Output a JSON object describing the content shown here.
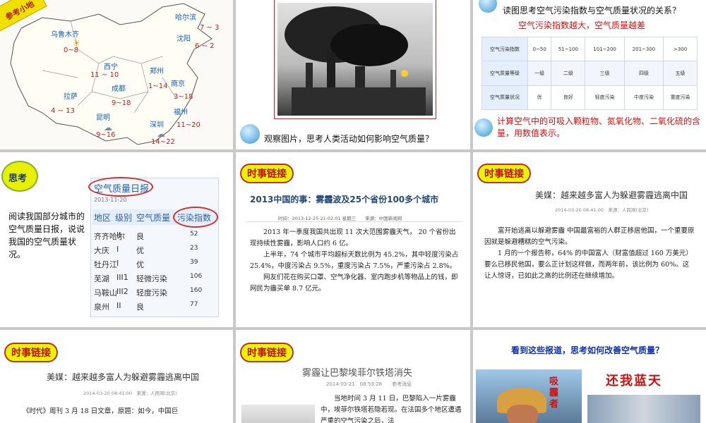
{
  "s1": {
    "badge": "参考小地",
    "cities": [
      {
        "name": "乌鲁木齐",
        "temp": "0~8"
      },
      {
        "name": "哈尔滨",
        "temp": "7 ~ 3"
      },
      {
        "name": "沈阳",
        "temp": "6 ~ 2"
      },
      {
        "name": "西宁",
        "temp": "11 ~ 10"
      },
      {
        "name": "郑州",
        "temp": "1~14"
      },
      {
        "name": "成都",
        "temp": "9~18"
      },
      {
        "name": "南京",
        "temp": "3~18"
      },
      {
        "name": "拉萨",
        "temp": "4 ~ 13"
      },
      {
        "name": "福州",
        "temp": "11~20"
      },
      {
        "name": "昆明",
        "temp": "9~16"
      },
      {
        "name": "深圳",
        "temp": "14~22"
      }
    ]
  },
  "s2": {
    "caption": "观察图片，思考人类活动如何影响空气质量？"
  },
  "s3": {
    "question": "读图思考空气污染指数与空气质量状况的关系？",
    "answer": "空气污染指数越大，空气质量越差",
    "rows": [
      {
        "label": "空气污染指数",
        "cells": [
          "0~50",
          "51~100",
          "101~200",
          "201~300",
          ">300"
        ]
      },
      {
        "label": "空气质量等级",
        "cells": [
          "一级",
          "二级",
          "三级",
          "四级",
          "五级"
        ]
      },
      {
        "label": "空气质量状况",
        "cells": [
          "优",
          "良好",
          "轻度污染",
          "中度污染",
          "重度污染"
        ]
      }
    ],
    "note": "计算空气中的可吸入颗粒物、氮氧化物、二氧化硫的含量，用数值表示。"
  },
  "s4": {
    "tag": "思考",
    "prompt": "阅读我国部分城市的空气质量日报，说说我国的空气质量状况。",
    "report_title": "空气质量日报",
    "report_date": "2013-11-20",
    "headers": [
      "地区",
      "级别",
      "空气质量",
      "污染指数"
    ],
    "rows": [
      [
        "齐齐哈尔",
        "II",
        "良",
        "52"
      ],
      [
        "大庆",
        "I",
        "优",
        "23"
      ],
      [
        "牡丹江",
        "I",
        "优",
        "39"
      ],
      [
        "芜湖",
        "III1",
        "轻微污染",
        "106"
      ],
      [
        "马鞍山",
        "III2",
        "轻度污染",
        "160"
      ],
      [
        "泉州",
        "II",
        "良",
        "77"
      ]
    ]
  },
  "s5": {
    "tag": "时事链接",
    "title": "2013中国的事：雾霾波及25个省份100多个城市",
    "meta": "时间：2013-12-25 21:02:01 星期三　　来源：中国新闻网",
    "paras": [
      "2013 年一季度我国共出现 11 次大范围雾霾天气， 20 个省份出现持续性雾霾，影响人口约 6 亿。",
      "上半年，74 个城市平均超标天数比例为 45.2%，其中轻度污染占 25.4%，中度污染占 9.5%，重度污染占 7.5%，严重污染占 2.8%。",
      "网友们花在购买口罩、空气净化器、室内跑步机等物品上的钱，即网民为霾买单 8.7 亿元。"
    ]
  },
  "s6": {
    "tag": "时事链接",
    "title": "美媒：越来越多富人为躲避雾霾逃离中国",
    "meta": "2014-03-20 08:41:00　来源：人民网(北京)",
    "paras": [
      "富开始逃离以躲避雾霾 中国最富裕的人群正移居他国，一个重要原因就是躲避糟糕的空气污染。",
      "1 月的一个报告称，64% 的中国富人（财富值超过 160 万美元）要么已移民他国，要么正计划这样做，而两年前，该比例为 60%。这让人惊讶，已如此之高的比例还在继续增加。"
    ]
  },
  "s7": {
    "tag": "时事链接",
    "title": "美媒：越来越多富人为躲避雾霾逃离中国",
    "meta": "2014-03-20 08:41:00　来源：人民网(北京)",
    "para": "《时代》周刊 3 月 18 日文章，原题：如今，中国巨"
  },
  "s8": {
    "tag": "时事链接",
    "title": "雾霾让巴黎埃菲尔铁塔消失",
    "meta": "2014-03-21　08:53:28　　参考消息",
    "para": "当地时间 3 月 11 日，巴黎陷入一片雾霾中，埃菲尔铁塔若隐若现。在法国多个地区遭遇严重的空气污染之后，法"
  },
  "s9": {
    "question": "看到这些报道，思考如何改善空气质量？",
    "slogan": "还我蓝天",
    "side_text": "吸 霾 者"
  }
}
